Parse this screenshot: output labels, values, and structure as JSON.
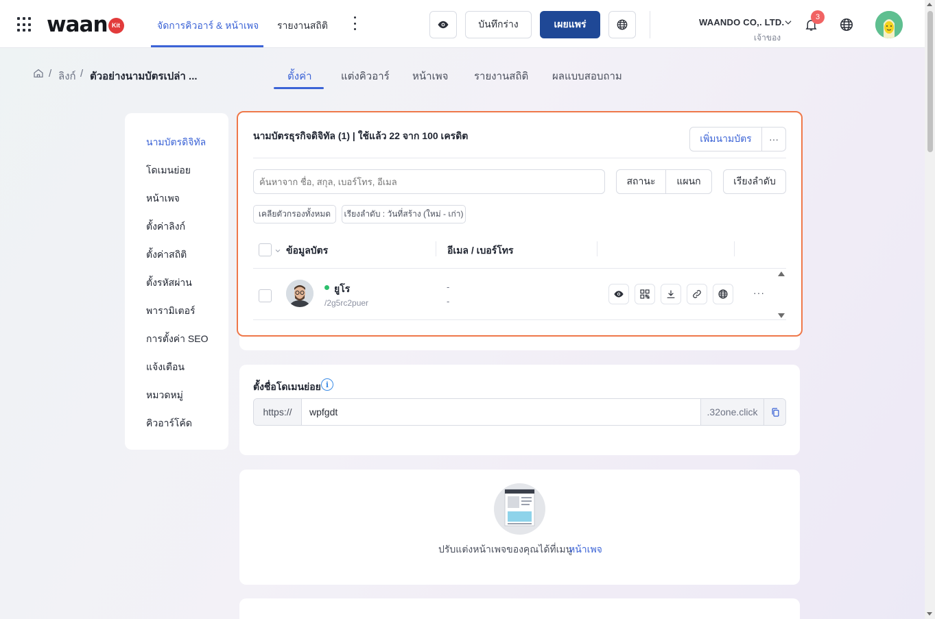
{
  "app": {
    "logo_text": "waan",
    "logo_badge": "Kit",
    "nav": [
      {
        "label": "จัดการคิวอาร์ & หน้าเพจ"
      },
      {
        "label": "รายงานสถิติ"
      }
    ],
    "buttons": {
      "draft": "บันทึกร่าง",
      "publish": "เผยแพร่"
    },
    "company": "WAANDO CO,. LTD.",
    "role": "เจ้าของ",
    "notification_count": "3"
  },
  "breadcrumb": {
    "link": "ลิงก์",
    "current": "ตัวอย่างนามบัตรเปล่า ..."
  },
  "subtabs": [
    {
      "label": "ตั้งค่า"
    },
    {
      "label": "แต่งคิวอาร์"
    },
    {
      "label": "หน้าเพจ"
    },
    {
      "label": "รายงานสถิติ"
    },
    {
      "label": "ผลแบบสอบถาม"
    }
  ],
  "sidemenu": [
    {
      "label": "นามบัตรดิจิทัล"
    },
    {
      "label": "โดเมนย่อย"
    },
    {
      "label": "หน้าเพจ"
    },
    {
      "label": "ตั้งค่าลิงก์"
    },
    {
      "label": "ตั้งค่าสถิติ"
    },
    {
      "label": "ตั้งรหัสผ่าน"
    },
    {
      "label": "พารามิเตอร์"
    },
    {
      "label": "การตั้งค่า SEO"
    },
    {
      "label": "แจ้งเตือน"
    },
    {
      "label": "หมวดหมู่"
    },
    {
      "label": "คิวอาร์โค้ด"
    }
  ],
  "cards_section": {
    "title": "นามบัตรธุรกิจดิจิทัล (1) | ใช้แล้ว 22 จาก 100 เครดิต",
    "add_button": "เพิ่มนามบัตร",
    "more_button": "···",
    "search_placeholder": "ค้นหาจาก ชื่อ, สกุล, เบอร์โทร, อีเมล",
    "filter_status": "สถานะ",
    "filter_department": "แผนก",
    "sort_button": "เรียงลำดับ",
    "chips": {
      "clear": "เคลียตัวกรองทั้งหมด",
      "sort_info": "เรียงลำดับ : วันที่สร้าง (ใหม่ - เก่า)"
    },
    "columns": {
      "info": "ข้อมูลบัตร",
      "contact": "อีเมล / เบอร์โทร"
    },
    "rows": [
      {
        "name": "ยูโร",
        "slug": "/2g5rc2puer",
        "email": "-",
        "phone": "-",
        "more": "···"
      }
    ]
  },
  "subdomain": {
    "title": "ตั้งชื่อโดเมนย่อย",
    "info_icon": "i",
    "prefix": "https://",
    "value": "wpfgdt",
    "suffix": ".32one.click"
  },
  "page_card": {
    "hint": "ปรับแต่งหน้าเพจของคุณได้ที่เมนู",
    "link": "หน้าเพจ"
  },
  "colors": {
    "accent": "#3b63d6",
    "primary_button": "#1f4896",
    "highlight_border": "#ef7748",
    "status_online": "#2dbf6d",
    "badge": "#f16363"
  }
}
